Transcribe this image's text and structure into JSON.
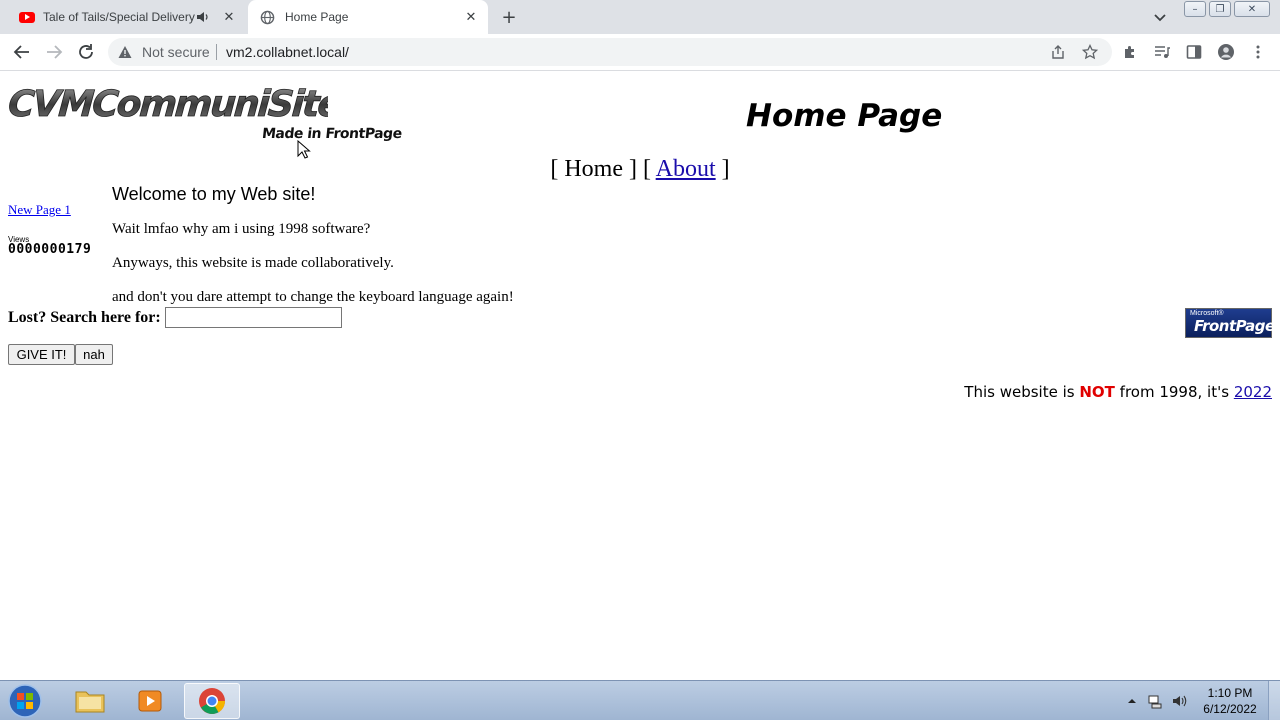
{
  "browser": {
    "tabs": [
      {
        "title": "Tale of Tails/Special Delivery",
        "icon": "youtube-icon",
        "audio": true
      },
      {
        "title": "Home Page",
        "icon": "globe-icon",
        "active": true
      }
    ],
    "security_label": "Not secure",
    "url": "vm2.collabnet.local/"
  },
  "page": {
    "logo_text": "CVMCommuniSite",
    "made_in": "Made in FrontPage",
    "heading": "Home Page",
    "nav": {
      "open1": "[ ",
      "home": "Home",
      "mid": " ] [ ",
      "about": "About",
      "close": " ]"
    },
    "sidebar_link": "New Page 1",
    "views_label": "Views",
    "views_count": "0000000179",
    "welcome": "Welcome to my Web site!",
    "paragraphs": [
      "Wait lmfao why am i using 1998 software?",
      "Anyways, this website is made collaboratively.",
      "and don't you dare attempt to change the keyboard language again!"
    ],
    "search_label": "Lost? Search here for:",
    "search_value": "",
    "submit_label": "GIVE IT!",
    "reset_label": "nah",
    "badge_small": "Microsoft®",
    "badge_big": "FrontPage",
    "footer": {
      "pre": "This website is ",
      "not": "NOT",
      "mid": " from 1998, it's ",
      "year": "2022"
    },
    "colors": {
      "link": "#1a0dab",
      "not_red": "#e00000"
    }
  },
  "taskbar": {
    "items": [
      "start-orb",
      "file-explorer",
      "media-player",
      "chrome"
    ],
    "time": "1:10 PM",
    "date": "6/12/2022"
  }
}
